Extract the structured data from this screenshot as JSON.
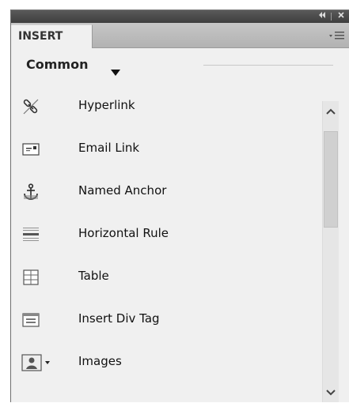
{
  "panel": {
    "tab_label": "INSERT",
    "category": "Common"
  },
  "items": [
    {
      "label": "Hyperlink",
      "icon": "hyperlink-icon"
    },
    {
      "label": "Email Link",
      "icon": "email-link-icon"
    },
    {
      "label": "Named Anchor",
      "icon": "named-anchor-icon"
    },
    {
      "label": "Horizontal Rule",
      "icon": "horizontal-rule-icon"
    },
    {
      "label": "Table",
      "icon": "table-icon"
    },
    {
      "label": "Insert Div Tag",
      "icon": "insert-div-tag-icon"
    },
    {
      "label": "Images",
      "icon": "images-icon"
    }
  ],
  "colors": {
    "titlebar": "#4a4a4a",
    "tabstrip": "#bcbcbc",
    "panel_bg": "#f0f0f0"
  }
}
